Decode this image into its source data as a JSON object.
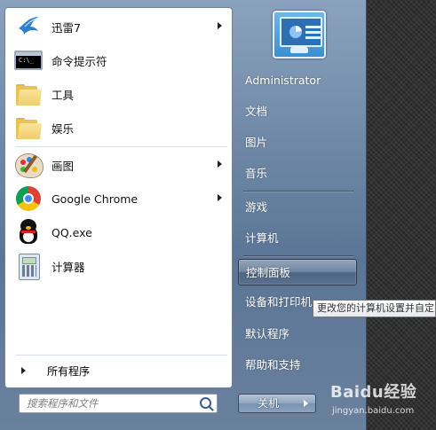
{
  "programs": [
    {
      "label": "迅雷7",
      "icon": "thunder-bird-icon",
      "has_submenu": true
    },
    {
      "label": "命令提示符",
      "icon": "command-prompt-icon",
      "has_submenu": false
    },
    {
      "label": "工具",
      "icon": "folder-icon",
      "has_submenu": false
    },
    {
      "label": "娱乐",
      "icon": "folder-icon",
      "has_submenu": false
    },
    {
      "label": "画图",
      "icon": "paint-palette-icon",
      "has_submenu": true
    },
    {
      "label": "Google Chrome",
      "icon": "chrome-icon",
      "has_submenu": true
    },
    {
      "label": "QQ.exe",
      "icon": "qq-penguin-icon",
      "has_submenu": false
    },
    {
      "label": "计算器",
      "icon": "calculator-icon",
      "has_submenu": false
    }
  ],
  "all_programs": "所有程序",
  "search": {
    "placeholder": "搜索程序和文件"
  },
  "cmd_icon_text": "C:\\_",
  "right_panel": {
    "user_name": "Administrator",
    "items": [
      "文档",
      "图片",
      "音乐",
      "游戏",
      "计算机",
      "控制面板",
      "设备和打印机",
      "默认程序",
      "帮助和支持"
    ],
    "highlighted": "控制面板"
  },
  "shutdown_label": "关机",
  "tooltip": "更改您的计算机设置并自定",
  "watermark": {
    "brand": "Baidu经验",
    "sub": "jingyan.baidu.com"
  },
  "colors": {
    "panel_blue": "#6d87a5",
    "highlight_border": "#2e3a48"
  }
}
